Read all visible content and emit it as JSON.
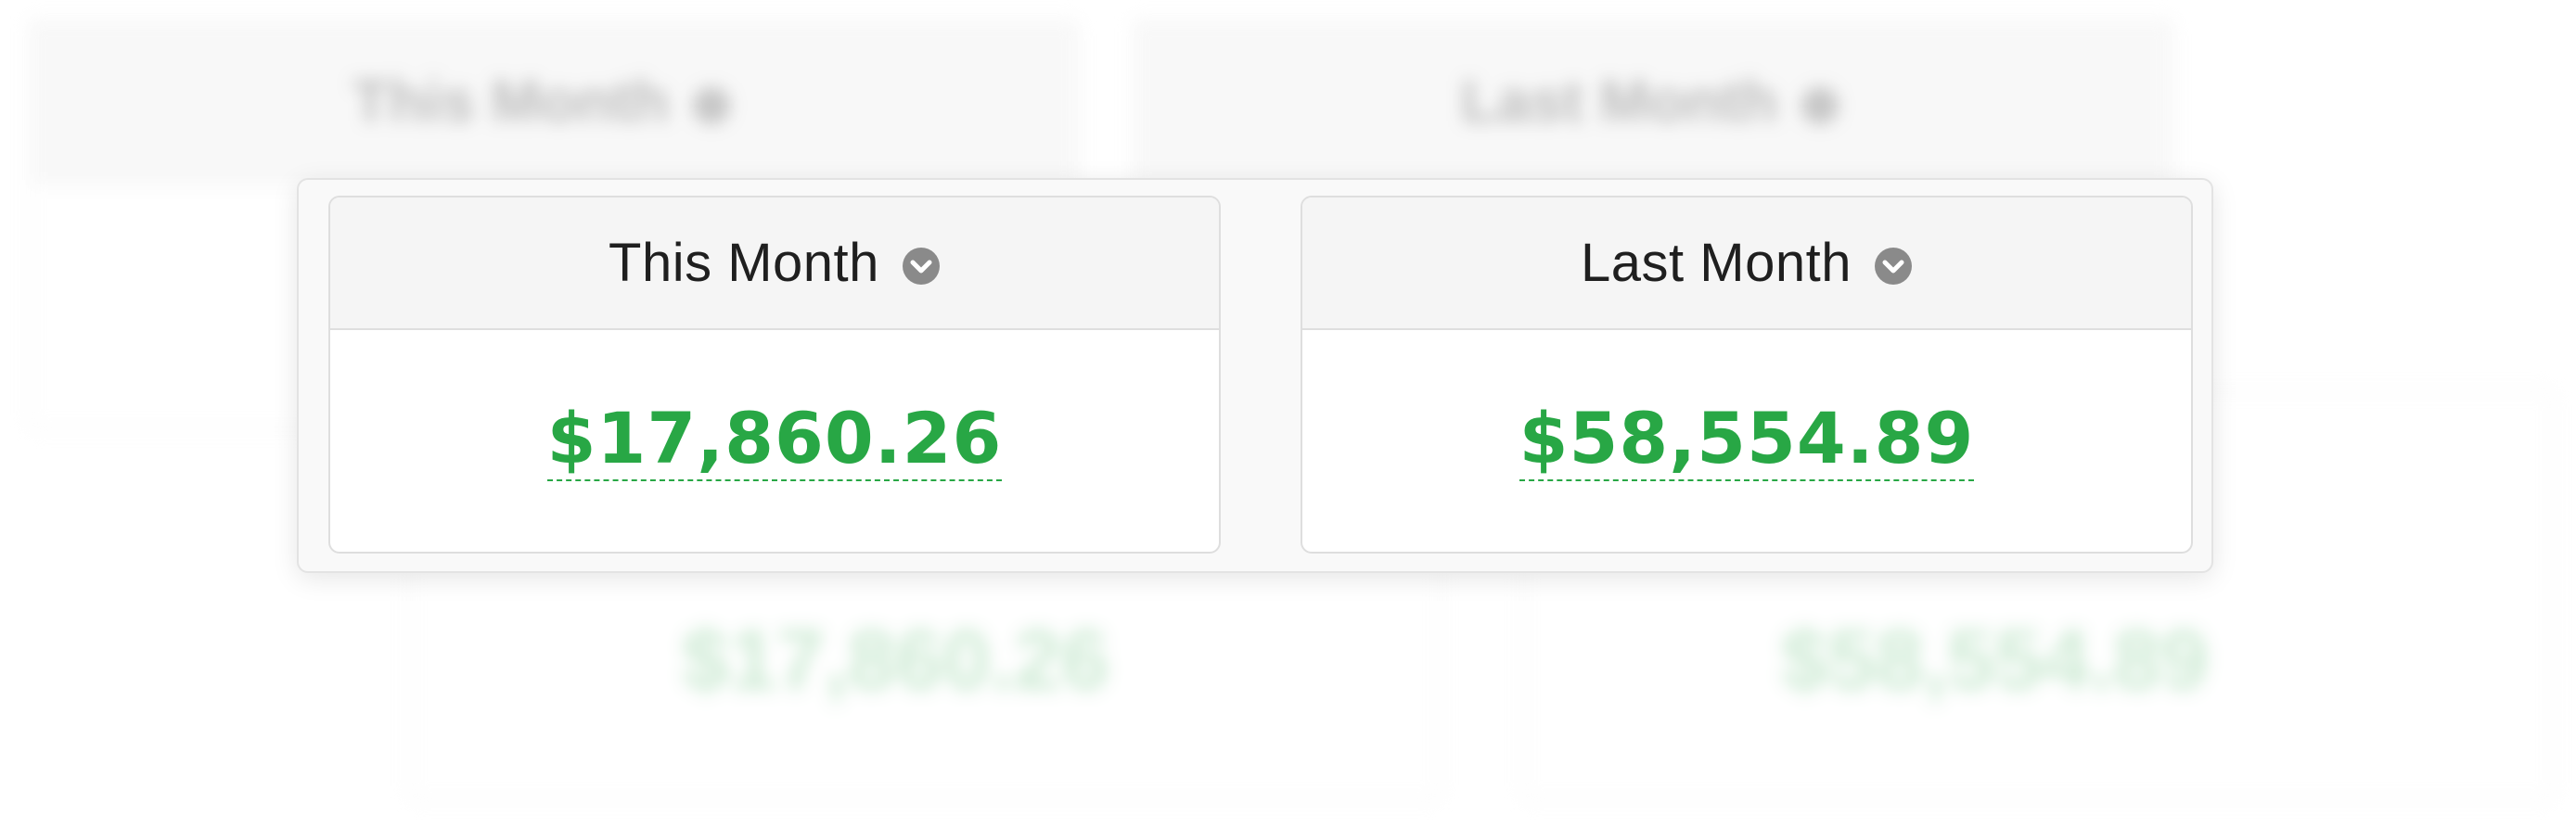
{
  "summary": {
    "this_month": {
      "label": "This Month",
      "amount": "$17,860.26"
    },
    "last_month": {
      "label": "Last Month",
      "amount": "$58,554.89"
    }
  },
  "colors": {
    "amount_green": "#28a745",
    "header_bg": "#f5f5f5",
    "chevron": "#8a8a8a"
  },
  "icons": {
    "dropdown": "chevron-down-circle-icon"
  }
}
